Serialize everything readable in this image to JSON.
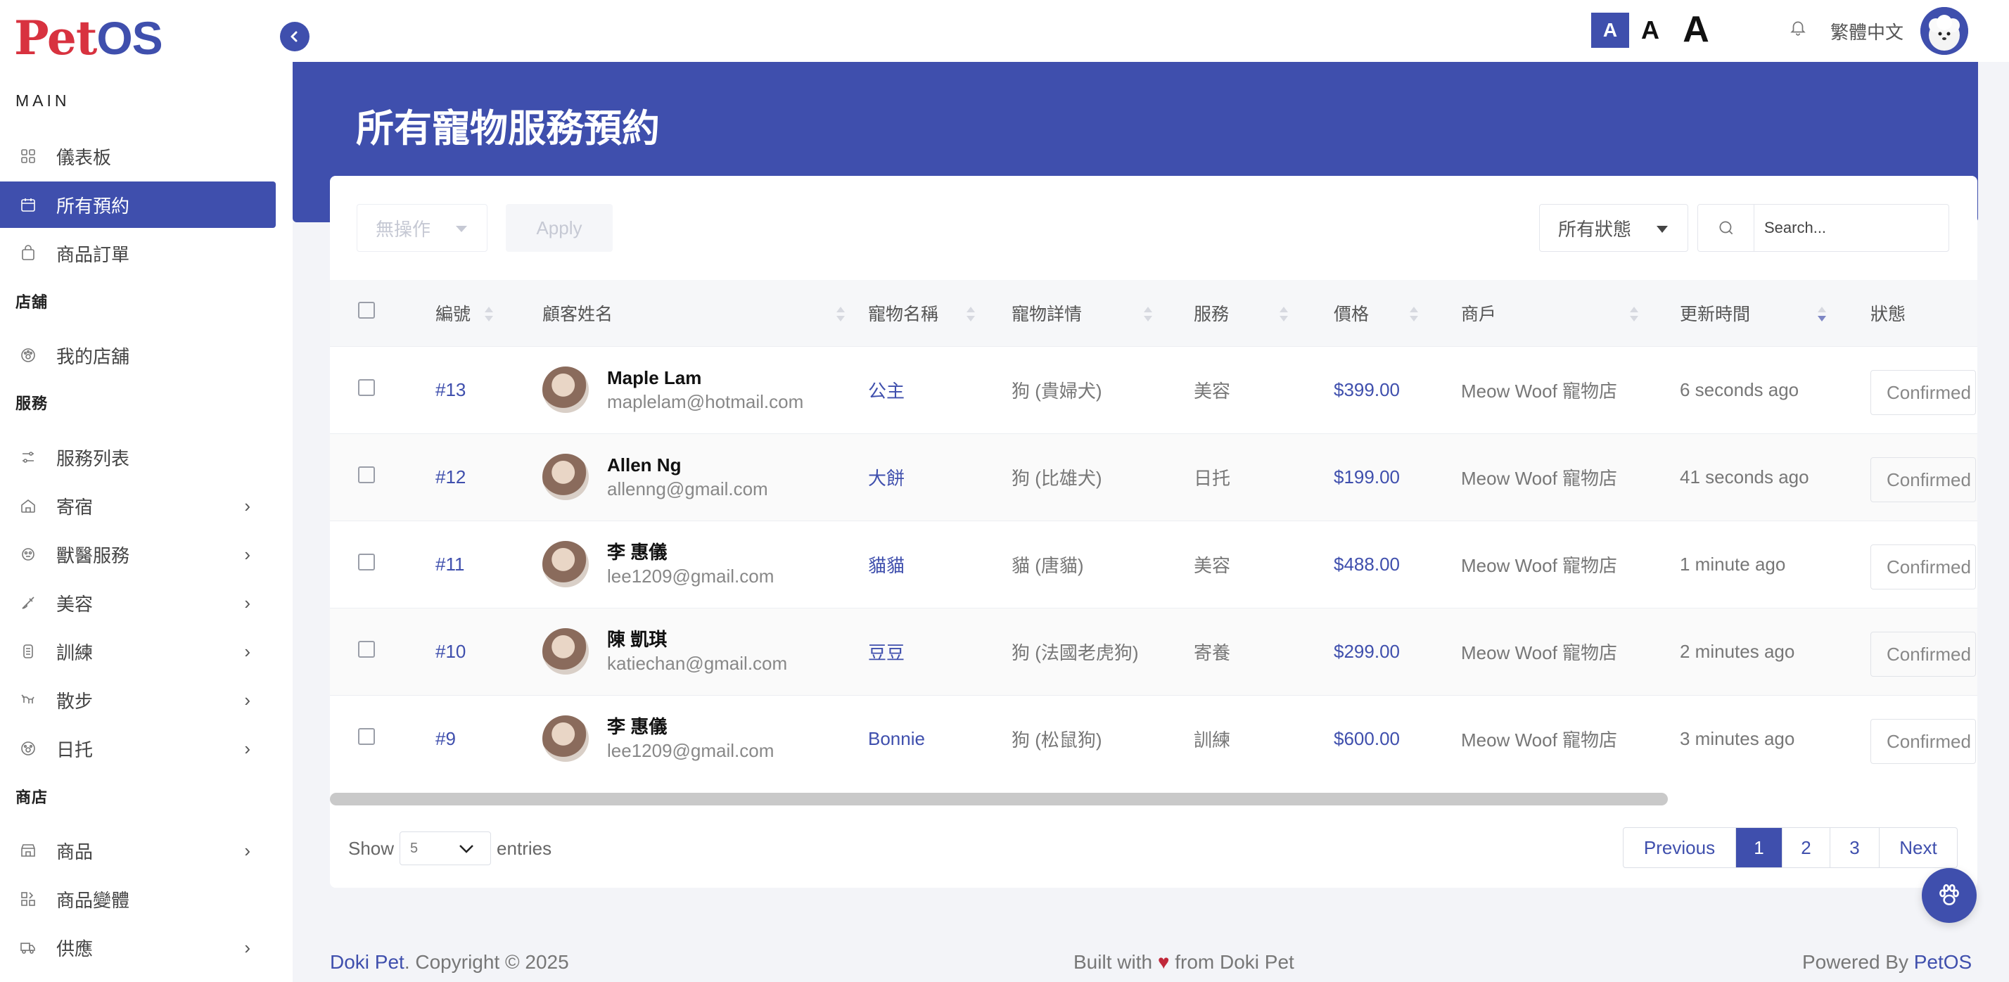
{
  "brand": {
    "logo_part1": "Pet",
    "logo_part2": "OS"
  },
  "colors": {
    "accent": "#3f4fad",
    "brand_red": "#d8323f",
    "heart": "#c0283a"
  },
  "sidebar": {
    "sections": {
      "main": "MAIN",
      "store": "店舖",
      "service": "服務",
      "shop": "商店"
    },
    "items": [
      {
        "label": "儀表板",
        "icon": "grid-icon"
      },
      {
        "label": "所有預約",
        "icon": "calendar-icon",
        "active": true
      },
      {
        "label": "商品訂單",
        "icon": "bag-icon"
      },
      {
        "label": "我的店舖",
        "icon": "paw-icon"
      },
      {
        "label": "服務列表",
        "icon": "sliders-icon"
      },
      {
        "label": "寄宿",
        "icon": "house-icon"
      },
      {
        "label": "獸醫服務",
        "icon": "vet-icon"
      },
      {
        "label": "美容",
        "icon": "brush-icon"
      },
      {
        "label": "訓練",
        "icon": "training-icon"
      },
      {
        "label": "散步",
        "icon": "walk-icon"
      },
      {
        "label": "日托",
        "icon": "daycare-icon"
      },
      {
        "label": "商品",
        "icon": "store-icon"
      },
      {
        "label": "商品變體",
        "icon": "variants-icon"
      },
      {
        "label": "供應",
        "icon": "truck-icon"
      }
    ]
  },
  "topbar": {
    "font_small": "A",
    "font_mid": "A",
    "font_big": "A",
    "language": "繁體中文"
  },
  "page": {
    "title": "所有寵物服務預約"
  },
  "toolbar": {
    "bulk_action": "無操作",
    "apply": "Apply",
    "status_filter": "所有狀態",
    "search_placeholder": "Search..."
  },
  "table": {
    "headers": {
      "id": "編號",
      "customer": "顧客姓名",
      "pet": "寵物名稱",
      "details": "寵物詳情",
      "service": "服務",
      "price": "價格",
      "merchant": "商戶",
      "updated": "更新時間",
      "status": "狀態"
    },
    "rows": [
      {
        "id": "#13",
        "name": "Maple Lam",
        "email": "maplelam@hotmail.com",
        "pet": "公主",
        "details": "狗 (貴婦犬)",
        "service": "美容",
        "price": "$399.00",
        "merchant": "Meow Woof 寵物店",
        "updated": "6 seconds ago",
        "status": "Confirmed"
      },
      {
        "id": "#12",
        "name": "Allen Ng",
        "email": "allenng@gmail.com",
        "pet": "大餅",
        "details": "狗 (比雄犬)",
        "service": "日托",
        "price": "$199.00",
        "merchant": "Meow Woof 寵物店",
        "updated": "41 seconds ago",
        "status": "Confirmed"
      },
      {
        "id": "#11",
        "name": "李 惠儀",
        "email": "lee1209@gmail.com",
        "pet": "貓貓",
        "details": "貓 (唐貓)",
        "service": "美容",
        "price": "$488.00",
        "merchant": "Meow Woof 寵物店",
        "updated": "1 minute ago",
        "status": "Confirmed"
      },
      {
        "id": "#10",
        "name": "陳 凱琪",
        "email": "katiechan@gmail.com",
        "pet": "豆豆",
        "details": "狗 (法國老虎狗)",
        "service": "寄養",
        "price": "$299.00",
        "merchant": "Meow Woof 寵物店",
        "updated": "2 minutes ago",
        "status": "Confirmed"
      },
      {
        "id": "#9",
        "name": "李 惠儀",
        "email": "lee1209@gmail.com",
        "pet": "Bonnie",
        "details": "狗 (松鼠狗)",
        "service": "訓練",
        "price": "$600.00",
        "merchant": "Meow Woof 寵物店",
        "updated": "3 minutes ago",
        "status": "Confirmed"
      }
    ]
  },
  "pagination": {
    "show": "Show",
    "page_size": "5",
    "entries": "entries",
    "previous": "Previous",
    "pages": [
      "1",
      "2",
      "3"
    ],
    "current": "1",
    "next": "Next"
  },
  "footer": {
    "brand": "Doki Pet",
    "copyright": ". Copyright © 2025",
    "built_with": "Built with",
    "heart": "♥",
    "from": "from Doki Pet",
    "powered_by": "Powered By",
    "petos": "PetOS"
  }
}
